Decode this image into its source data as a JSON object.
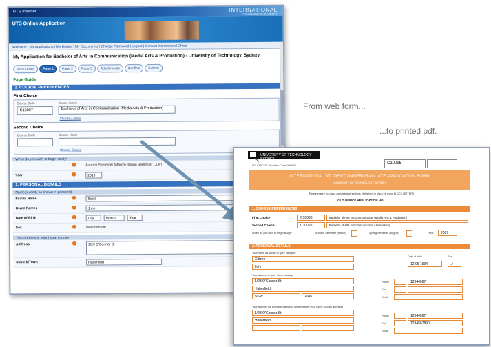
{
  "captions": {
    "from": "From web form...",
    "to": "...to printed pdf."
  },
  "webform": {
    "topbar_left": "UTS Internet",
    "topbar_right": "INTERNATIONAL",
    "topbar_sub": "INTERNATIONAL STUDENT",
    "banner_title": "UTS Online Application",
    "nav": "Welcome | My Applications | My Details | My Documents | Change Password | Logout | Contact International Office",
    "application_heading": "My Application for Bachelor of Arts in Communication (Media Arts & Production) - University of Technology, Sydney",
    "steps": [
      "Introduction",
      "Page 1",
      "Page 2",
      "Page 3",
      "Attachments",
      "Confirm",
      "Submit"
    ],
    "active_step": 1,
    "green_label": "Page Guide",
    "section1": "1. COURSE PREFERENCES",
    "first_choice": "First Choice",
    "second_choice": "Second Choice",
    "col_code": "Course Code",
    "col_name": "Course Name",
    "first_code": "C10097",
    "first_name": "Bachelor of Arts in Communication (Media Arts & Production)",
    "choose_link": "Choose Course",
    "intake_hdr": "When do you wish to begin study?",
    "intake_options": "Autumn Semester (March)  Spring Semester (July)",
    "year_label": "Year",
    "year_value": "2010",
    "section2": "2. PERSONAL DETAILS",
    "name_hdr": "Name (exactly as shown in passport)",
    "family_label": "Family Name",
    "family_value": "Scott",
    "given_label": "Given Names",
    "given_value": "John",
    "dob_label": "Date of Birth",
    "dob_day": "Day",
    "dob_month": "Month",
    "dob_year": "Year",
    "sex_label": "Sex",
    "sex_value": "Male  Female",
    "addr_hdr": "Your address in your home country",
    "addr_label": "Address",
    "addr_value": "1/23 O'Connor St",
    "suburb_label": "Suburb/Town",
    "suburb_value": "Haberfield"
  },
  "pdf": {
    "logo": "UNIVERSITY OF TECHNOLOGY SYDNEY",
    "course_code": "C10096",
    "cricos": "UTS CRICOS Provider Code 00099F",
    "title": "INTERNATIONAL STUDENT UNDERGRADUATE APPLICATION FORM",
    "subtitle": "UNIVERSITY OF TECHNOLOGY, SYDNEY",
    "note": "Please ensure you have completed all sections of this form in black ink using BLOCK LETTERS",
    "office": "OLD OFFICE APPLICATION NO",
    "sec1": "1. COURSE PREFERENCES",
    "first_pref": "First Choice",
    "second_pref": "Second Choice",
    "code1": "C10096",
    "name1": "Bachelor of Arts in Communication (Media Arts & Production)",
    "code2": "C10022",
    "name2": "Bachelor of Arts in Communication (Journalism)",
    "intake_label": "When do you wish to begin study?",
    "autumn": "Autumn Semester (March)",
    "spring": "Spring Semester (August)",
    "year_label": "Year",
    "year_value": "2009",
    "sec2": "2. PERSONAL DETAILS",
    "name_note": "Your name as shown in your passport",
    "family": "Citizen",
    "given": "John",
    "dob_label": "Date of birth",
    "dob": "12  05  1994",
    "sex_label": "Sex",
    "addr_note": "Your address in your home country",
    "street": "1/23 O'Connor St",
    "suburb": "Haberfield",
    "state": "NSW",
    "postcode": "2045",
    "phone_label": "Phone",
    "phone": "12344567",
    "fax_label": "Fax",
    "email_label": "Email",
    "corr_note": "Your address for correspondence (if different from your home country address)",
    "street2": "1/23 O'Connor St",
    "suburb2": "Haberfield",
    "phone2": "12344567",
    "fax2": "1234567890"
  }
}
